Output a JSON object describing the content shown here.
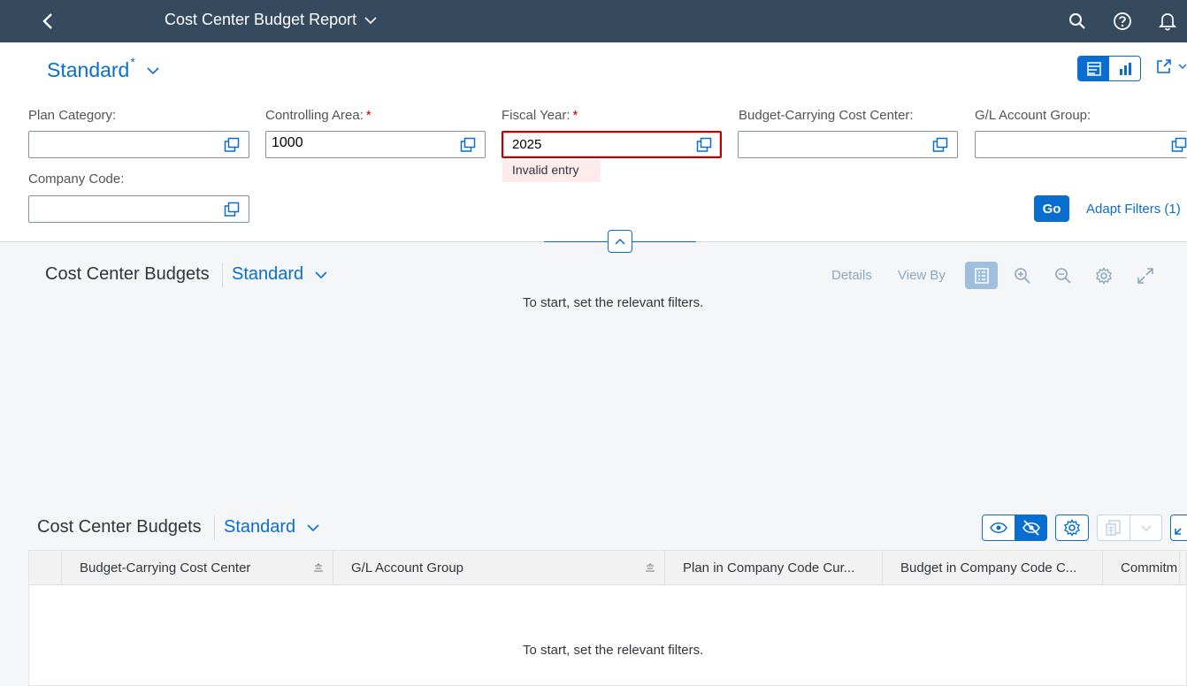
{
  "shell": {
    "title": "Cost Center Budget Report"
  },
  "variant": {
    "name": "Standard",
    "modified_marker": "*"
  },
  "filters": {
    "plan_category": {
      "label": "Plan Category:",
      "value": ""
    },
    "controlling_area": {
      "label": "Controlling Area:",
      "required_marker": "*",
      "value": "1000"
    },
    "fiscal_year": {
      "label": "Fiscal Year:",
      "required_marker": "*",
      "value": "2025",
      "error": "Invalid entry"
    },
    "budget_carrying_cost_center": {
      "label": "Budget-Carrying Cost Center:",
      "value": ""
    },
    "gl_account_group": {
      "label": "G/L Account Group:",
      "value": ""
    },
    "company_code": {
      "label": "Company Code:",
      "value": ""
    },
    "go_label": "Go",
    "adapt_filters_label": "Adapt Filters (1)"
  },
  "chart_section": {
    "title": "Cost Center Budgets",
    "variant": "Standard",
    "details_label": "Details",
    "view_by_label": "View By",
    "empty_text": "To start, set the relevant filters."
  },
  "table_section": {
    "title": "Cost Center Budgets",
    "variant": "Standard",
    "columns": [
      {
        "label": "Budget-Carrying Cost Center"
      },
      {
        "label": "G/L Account Group"
      },
      {
        "label": "Plan in Company Code Cur..."
      },
      {
        "label": "Budget in Company Code C..."
      },
      {
        "label": "Commitm"
      }
    ],
    "empty_text": "To start, set the relevant filters."
  },
  "colors": {
    "shell_bg": "#354a5f",
    "accent": "#0a6ed1",
    "error": "#bb0000"
  }
}
